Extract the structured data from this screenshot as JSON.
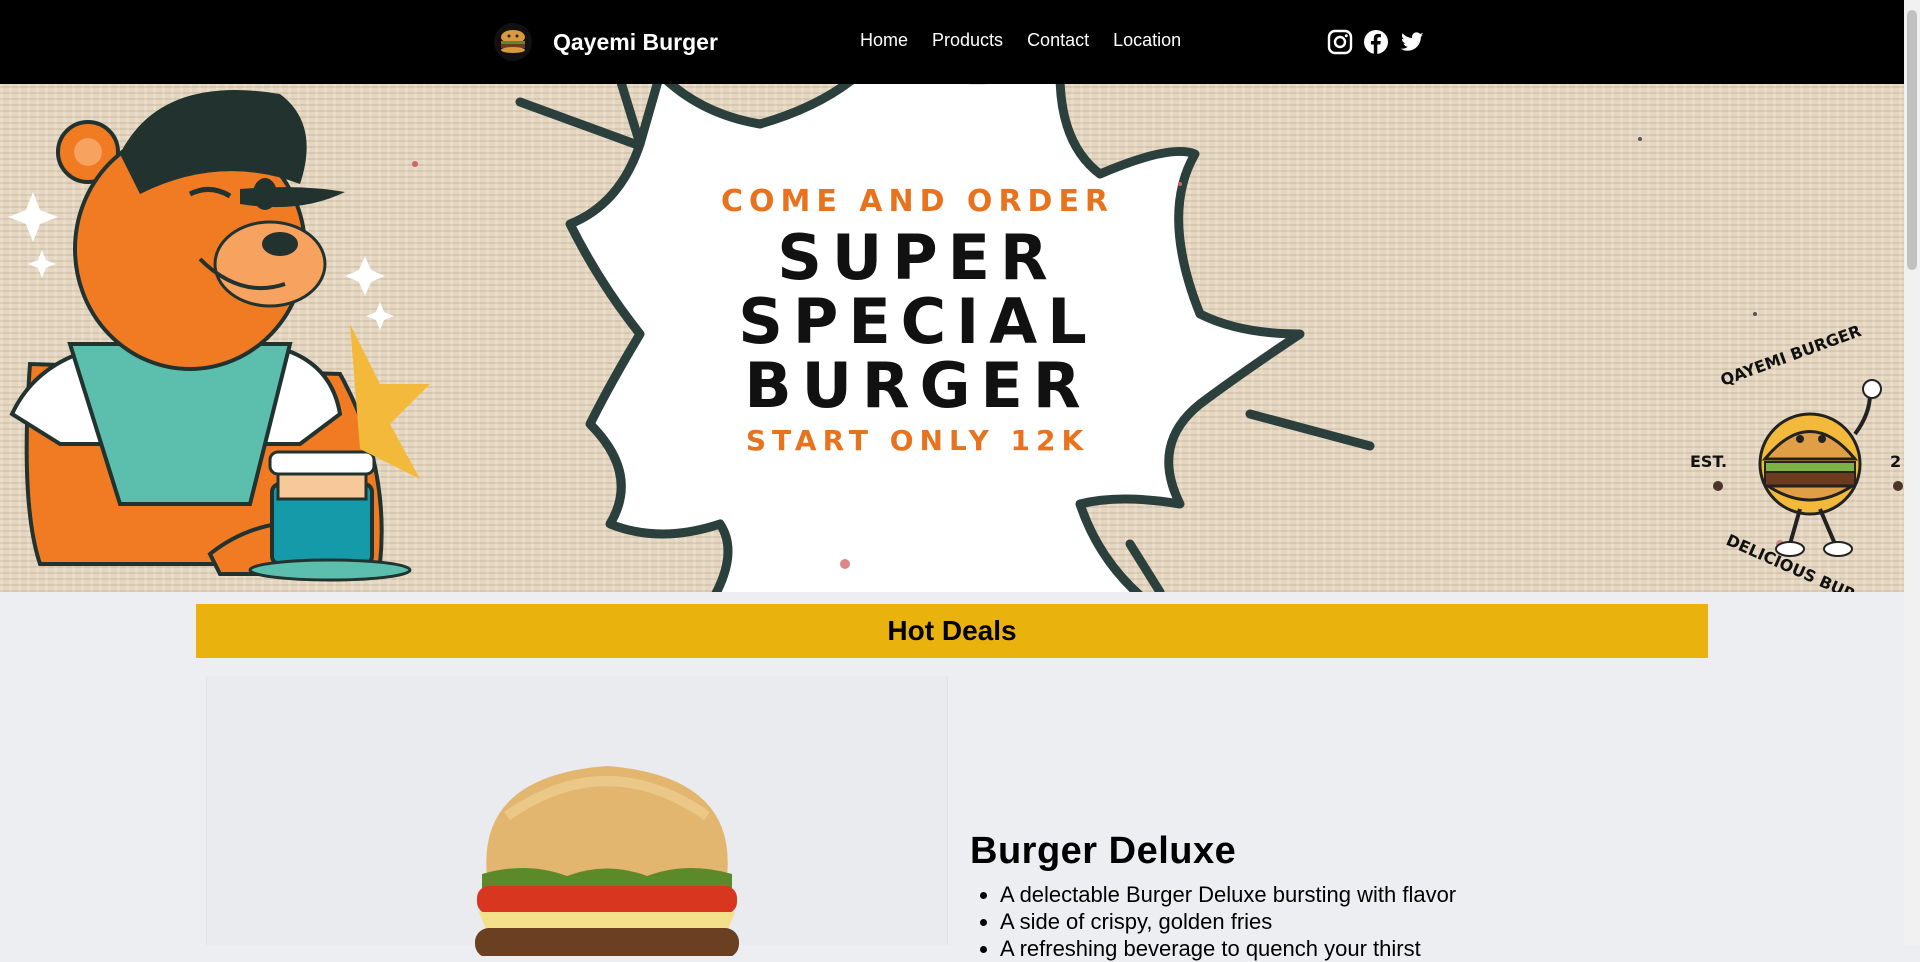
{
  "navbar": {
    "brand_name": "Qayemi Burger",
    "links": [
      "Home",
      "Products",
      "Contact",
      "Location"
    ],
    "social_icons": [
      "instagram-icon",
      "facebook-icon",
      "twitter-icon"
    ]
  },
  "hero": {
    "kicker": "COME AND ORDER",
    "headline_lines": [
      "SUPER",
      "SPECIAL",
      "BURGER"
    ],
    "price_text": "START ONLY 12K",
    "badge": {
      "top_text": "QAYEMI BURGER",
      "bottom_text": "DELICIOUS BURGER",
      "est_text": "EST.",
      "est_year_partial": "2"
    }
  },
  "deals": {
    "title": "Hot Deals",
    "product": {
      "name": "Burger Deluxe",
      "features": [
        "A delectable Burger Deluxe bursting with flavor",
        "A side of crispy, golden fries",
        "A refreshing beverage to quench your thirst"
      ]
    }
  },
  "colors": {
    "navbar_bg": "#000000",
    "deals_bar": "#e9b20c",
    "accent_orange": "#e8731f",
    "page_bg": "#eceef1"
  }
}
